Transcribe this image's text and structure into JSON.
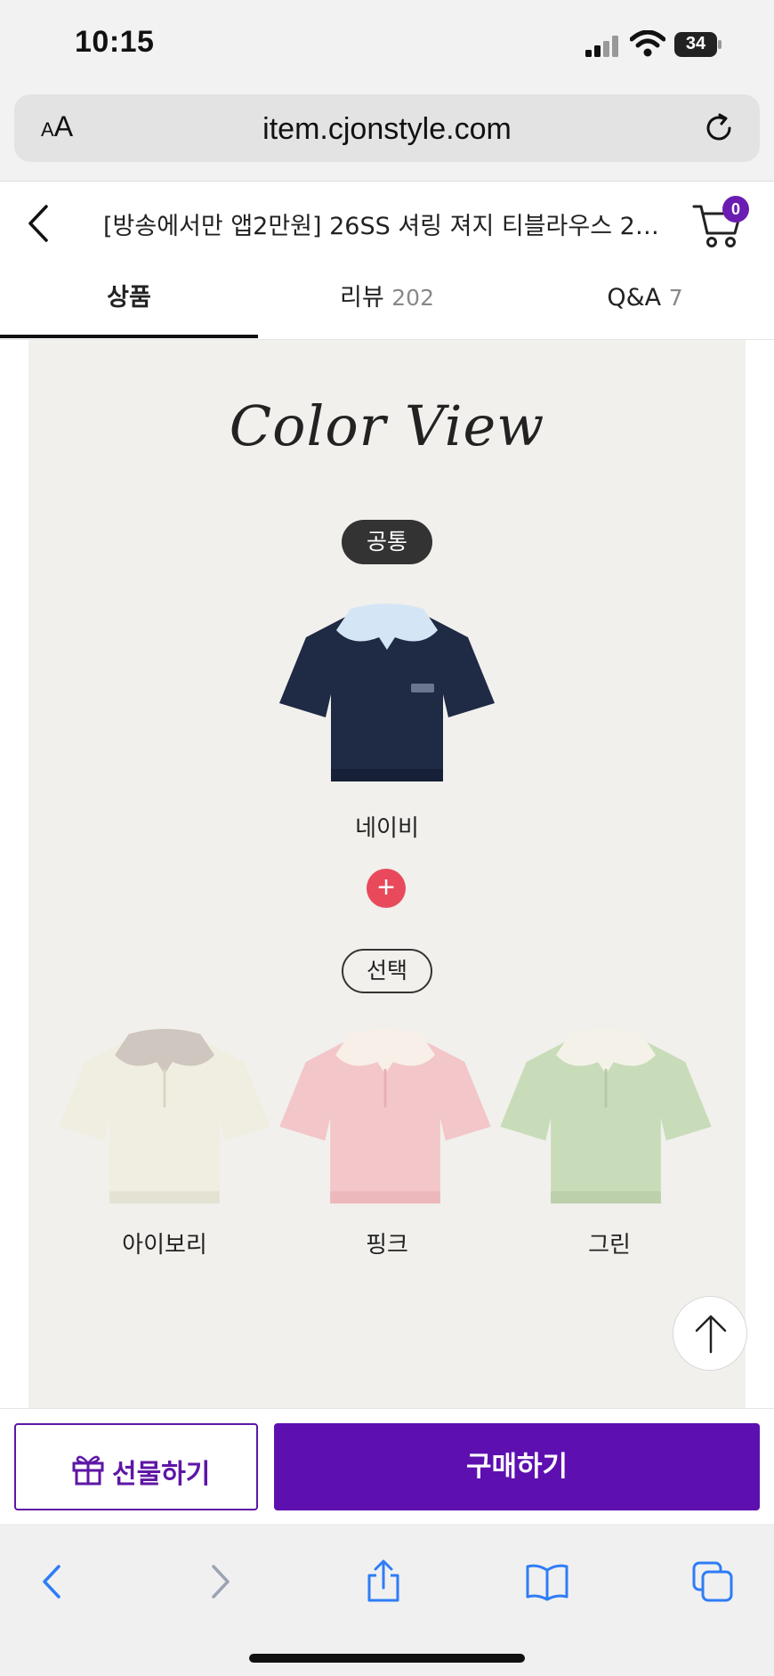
{
  "status_bar": {
    "time": "10:15",
    "battery": "34"
  },
  "browser": {
    "aa_small": "A",
    "aa_big": "A",
    "url": "item.cjonstyle.com"
  },
  "header": {
    "title": "[방송에서만 앱2만원] 26SS 셔링 져지 티블라우스 2종...",
    "cart_count": "0"
  },
  "tabs": [
    {
      "label": "상품",
      "count": "",
      "active": true
    },
    {
      "label": "리뷰",
      "count": "202",
      "active": false
    },
    {
      "label": "Q&A",
      "count": "7",
      "active": false
    }
  ],
  "content": {
    "heading": "Color View",
    "common_label": "공통",
    "choice_label": "선택",
    "plus": "+",
    "main_shirt": {
      "name": "네이비",
      "body": "#1f2a44",
      "collar": "#d4e6f5"
    },
    "options": [
      {
        "name": "아이보리",
        "body": "#efeee0",
        "collar": "#cfc6c0"
      },
      {
        "name": "핑크",
        "body": "#f3c6c9",
        "collar": "#f7efe8"
      },
      {
        "name": "그린",
        "body": "#c9dcb9",
        "collar": "#f4f2e8"
      }
    ]
  },
  "actions": {
    "gift": "선물하기",
    "buy": "구매하기"
  },
  "colors": {
    "brand_purple": "#5e0fb0",
    "accent_red": "#e84a5b",
    "safari_blue": "#2f7cf6"
  },
  "icons": [
    "back-icon",
    "cart-icon",
    "reload-icon",
    "gift-icon",
    "arrow-up-icon",
    "share-icon",
    "bookmarks-icon",
    "tabs-icon"
  ]
}
